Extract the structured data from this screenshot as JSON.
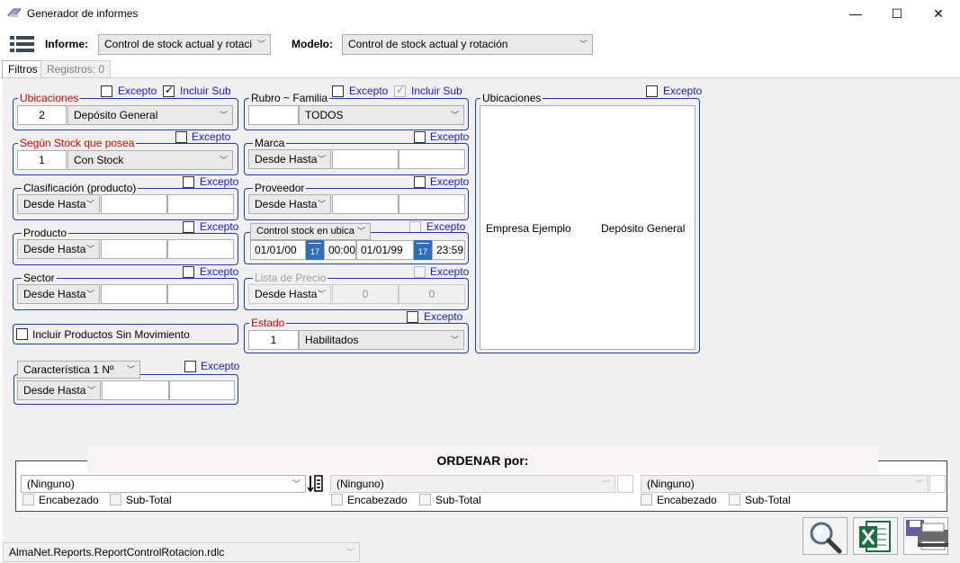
{
  "window": {
    "title": "Generador de informes",
    "minimize": "—",
    "maximize": "☐",
    "close": "✕"
  },
  "toolbar": {
    "informe_label": "Informe:",
    "informe_value": "Control de stock actual y rotaci",
    "modelo_label": "Modelo:",
    "modelo_value": "Control de stock actual y rotación"
  },
  "tabs": [
    "Filtros",
    "Registros: 0"
  ],
  "filters": {
    "excepto": "Excepto",
    "incluir_sub": "Incluir Sub",
    "ubicaciones": {
      "title": "Ubicaciones",
      "code": "2",
      "value": "Depósito General"
    },
    "stock": {
      "title": "Según Stock que posea",
      "code": "1",
      "value": "Con Stock"
    },
    "clasificacion": {
      "title": "Clasificación (producto)",
      "mode": "Desde Hasta"
    },
    "producto": {
      "title": "Producto",
      "mode": "Desde Hasta"
    },
    "sector": {
      "title": "Sector",
      "mode": "Desde Hasta"
    },
    "sin_mov": "Incluir Productos Sin Movimiento",
    "caracteristica": {
      "title": "Característica 1 Nº",
      "mode": "Desde Hasta"
    },
    "rubro": {
      "title": "Rubro ~ Familia",
      "value": "TODOS"
    },
    "marca": {
      "title": "Marca",
      "mode": "Desde Hasta"
    },
    "proveedor": {
      "title": "Proveedor",
      "mode": "Desde Hasta"
    },
    "control": {
      "title": "Control stock en ubica",
      "date_from": "01/01/00",
      "time_from": "00:00",
      "date_to": "01/01/99",
      "time_to": "23:59",
      "cal_day": "17"
    },
    "lista_precio": {
      "title": "Lista de Precio",
      "mode": "Desde Hasta",
      "from": "0",
      "to": "0"
    },
    "estado": {
      "title": "Estado",
      "code": "1",
      "value": "Habilitados"
    },
    "ubic_list": {
      "title": "Ubicaciones",
      "col1": "Empresa Ejemplo",
      "col2": "Depósito General"
    }
  },
  "order": {
    "title": "ORDENAR  por:",
    "slots": [
      {
        "value": "(Ninguno)",
        "encabezado": "Encabezado",
        "subtotal": "Sub-Total"
      },
      {
        "value": "(Ninguno)",
        "encabezado": "Encabezado",
        "subtotal": "Sub-Total"
      },
      {
        "value": "(Ninguno)",
        "encabezado": "Encabezado",
        "subtotal": "Sub-Total"
      }
    ]
  },
  "report_file": "AlmaNet.Reports.ReportControlRotacion.rdlc",
  "icons": [
    "app-icon",
    "menu-icon",
    "sort-icon",
    "search-icon",
    "excel-icon",
    "save-print-icon",
    "calendar-icon",
    "chevron-down-icon"
  ]
}
